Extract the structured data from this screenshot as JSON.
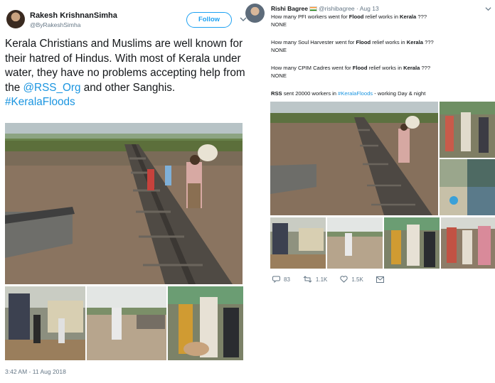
{
  "left_tweet": {
    "author_name": "Rakesh KrishnanSimha",
    "author_handle": "@ByRakeshSimha",
    "follow_label": "Follow",
    "text_part1": "Kerala Christians and Muslims are well known for their hatred of Hindus. With most of Kerala under water, they have no problems accepting help from the ",
    "mention": "@RSS_Org",
    "text_part2": " and other Sanghis.",
    "hashtag": "#KeralaFloods",
    "timestamp": "3:42 AM - 11 Aug 2018",
    "photos": [
      "flooded railway track with people carrying sacks",
      "trucks in flood water",
      "people wading through flood",
      "volunteers carrying supplies"
    ]
  },
  "right_tweet": {
    "author_name": "Rishi Bagree",
    "author_handle": "@rishibagree",
    "date": "· Aug 13",
    "q1_a": "How many PFI workers went for ",
    "q1_b": "Flood",
    "q1_c": " relief works in ",
    "q1_d": "Kerala",
    "q1_e": " ???",
    "q2_a": "How many Soul Harvester went for ",
    "q2_b": "Flood",
    "q2_c": " relief works in ",
    "q2_d": "Kerala",
    "q2_e": " ???",
    "q3_a": "How many CPIM Cadres went for ",
    "q3_b": "Flood",
    "q3_c": " relief works in ",
    "q3_d": "Kerala",
    "q3_e": " ???",
    "none": "NONE",
    "rss_bold": "RSS",
    "rss_text": " sent 20000 workers in ",
    "rss_tag": "#KeralaFloods",
    "rss_end": " - working Day & night",
    "reply_count": "83",
    "retweet_count": "1.1K",
    "like_count": "1.5K",
    "icons": [
      "reply-icon",
      "retweet-icon",
      "heart-icon",
      "mail-icon"
    ]
  },
  "colors": {
    "link": "#1b95e0",
    "muted": "#657786",
    "follow": "#1da1f2"
  }
}
